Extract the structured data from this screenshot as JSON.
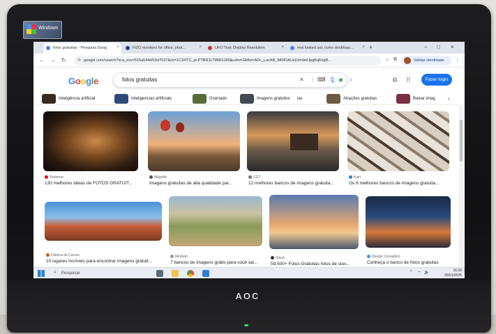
{
  "monitor": {
    "brand": "AOC",
    "sticker_text": "Windows"
  },
  "browser": {
    "tabs": [
      {
        "title": "fotos gratuitas - Pesquisa Goog",
        "active": true,
        "color": "#4285f4"
      },
      {
        "title": "FIZO monitors for office, phot...",
        "active": false,
        "color": "#1a3fa0"
      },
      {
        "title": "UFO Test: Display Resolution",
        "active": false,
        "color": "#c0392b"
      },
      {
        "title": "real looked aoc como desbloqu...",
        "active": false,
        "color": "#4285f4"
      }
    ],
    "new_tab": "+",
    "url": "google.com/search?sca_esv=515a544df15d7637&rlz=1C1RTC_pt-PTBR1179BR1180&udm=2&fbs=ADc_LacAB_IMMOAUsDcmbhlJpgBqRsgB...",
    "profile_label": "Validar identidade"
  },
  "google": {
    "logo": "Google",
    "query": "fotos gratuitas",
    "login_label": "Fazer login",
    "chips": [
      {
        "label": "Inteligência artificial",
        "color": "#3b2a1e"
      },
      {
        "label": "Inteligencias artificiais",
        "color": "#2d4b7a"
      },
      {
        "label": "Gramado",
        "color": "#5a6b3a"
      },
      {
        "label": "Imagens gratuitos",
        "color": "#444a52"
      },
      {
        "label": "ias",
        "color": ""
      },
      {
        "label": "Atrações gratuitas",
        "color": "#6b5a40"
      },
      {
        "label": "Baixar imag",
        "color": "#7a3040"
      }
    ],
    "results": [
      {
        "source": "Pinterest",
        "title": "130 melhores ideias de FOTOS GRATUIT...",
        "src_color": "#e60023"
      },
      {
        "source": "Magnific",
        "title": "Imagens gratuitas de alta qualidade par...",
        "src_color": "#555"
      },
      {
        "source": "CGT",
        "title": "12 melhores bancos de imagens gratuita...",
        "src_color": "#777"
      },
      {
        "source": "Kairi",
        "title": "Os 6 melhores bancos de imagens gratuita...",
        "src_color": "#2a7fd4"
      },
      {
        "source": "Fábrica de Cursos",
        "title": "10 lugares incríveis para encontrar imagens gratuit...",
        "src_color": "#d35400"
      },
      {
        "source": "Medium",
        "title": "7 bancos de imagens grátis para você sal...",
        "src_color": "#999"
      },
      {
        "source": "iStock",
        "title": "59.500+ Fotos Grátuitas fotos de stoc...",
        "src_color": "#333"
      },
      {
        "source": "Design Consultivo",
        "title": "Conheça o banco de fotos gratuitas",
        "src_color": "#3a9ad9"
      }
    ]
  },
  "taskbar": {
    "search_placeholder": "Pesquisar",
    "time": "16:20",
    "date": "25/01/2025"
  }
}
